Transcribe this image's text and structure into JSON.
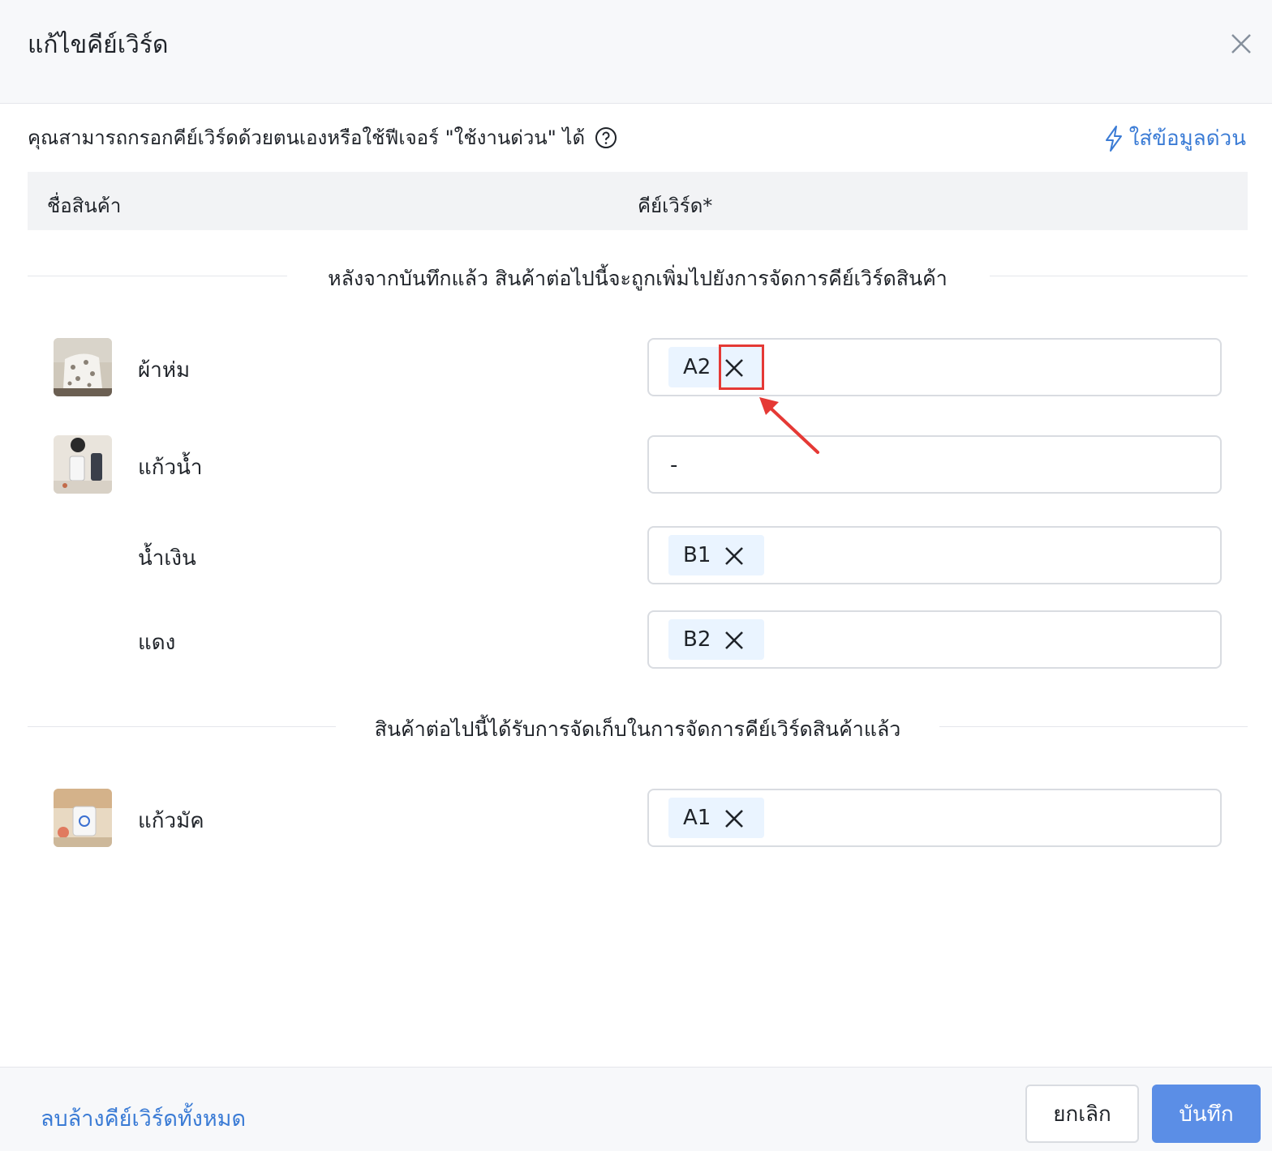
{
  "dialog": {
    "title": "แก้ไขคีย์เวิร์ด",
    "description": "คุณสามารถกรอกคีย์เวิร์ดด้วยตนเองหรือใช้ฟีเจอร์ \"ใช้งานด่วน\" ได้",
    "quick_fill_label": "ใส่ข้อมูลด่วน"
  },
  "table": {
    "col_product": "ชื่อสินค้า",
    "col_keyword": "คีย์เวิร์ด*"
  },
  "section_new": {
    "label": "หลังจากบันทึกแล้ว สินค้าต่อไปนี้จะถูกเพิ่มไปยังการจัดการคีย์เวิร์ดสินค้า",
    "rows": [
      {
        "name": "ผ้าห่ม",
        "keyword": "A2"
      },
      {
        "name": "แก้วน้ำ",
        "keyword": "-"
      },
      {
        "name": "น้ำเงิน",
        "keyword": "B1"
      },
      {
        "name": "แดง",
        "keyword": "B2"
      }
    ]
  },
  "section_existing": {
    "label": "สินค้าต่อไปนี้ได้รับการจัดเก็บในการจัดการคีย์เวิร์ดสินค้าแล้ว",
    "rows": [
      {
        "name": "แก้วมัค",
        "keyword": "A1"
      }
    ]
  },
  "footer": {
    "clear_all_label": "ลบล้างคีย์เวิร์ดทั้งหมด",
    "cancel_label": "ยกเลิก",
    "save_label": "บันทึก"
  },
  "colors": {
    "accent": "#3a7bd5",
    "primary_button": "#5b8ee6",
    "tag_bg": "#eaf4ff",
    "highlight": "#e53935"
  }
}
